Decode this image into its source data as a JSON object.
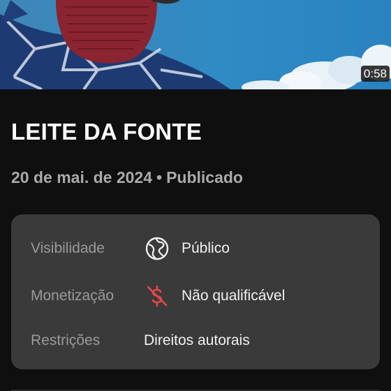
{
  "video": {
    "duration": "0:58",
    "title": "LEITE DA FONTE",
    "date": "20 de mai. de 2024",
    "separator": "•",
    "status": "Publicado"
  },
  "details": {
    "visibility": {
      "label": "Visibilidade",
      "value": "Público",
      "icon": "globe-icon"
    },
    "monetization": {
      "label": "Monetização",
      "value": "Não qualificável",
      "icon": "monetization-off-icon",
      "icon_color": "#e8474a"
    },
    "restrictions": {
      "label": "Restrições",
      "value": "Direitos autorais"
    }
  }
}
